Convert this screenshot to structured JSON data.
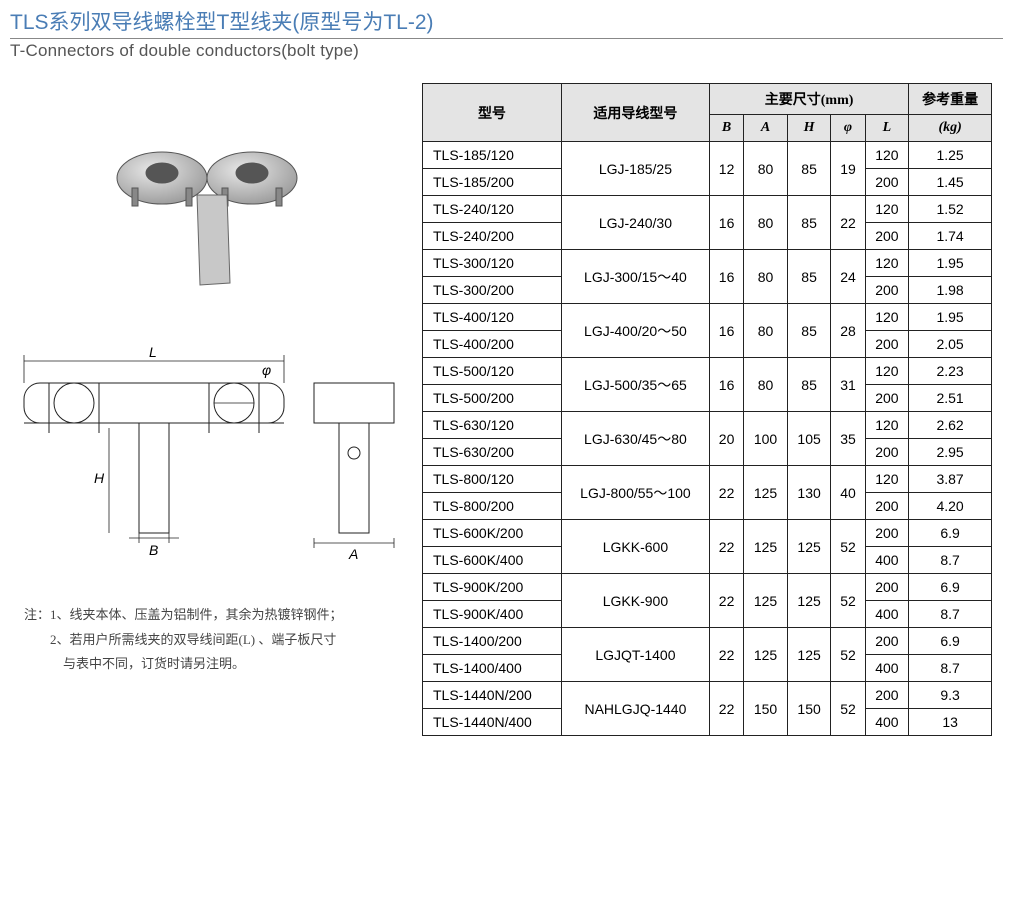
{
  "header": {
    "title_cn": "TLS系列双导线螺栓型T型线夹(原型号为TL-2)",
    "title_en": "T-Connectors of double conductors(bolt type)"
  },
  "notes": {
    "prefix": "注：",
    "line1": "1、线夹本体、压盖为铝制件，其余为热镀锌钢件；",
    "line2": "2、若用户所需线夹的双导线间距(L) 、端子板尺寸",
    "line2b": "与表中不同，订货时请另注明。"
  },
  "table": {
    "headers": {
      "model": "型号",
      "conductor": "适用导线型号",
      "dims": "主要尺寸(mm)",
      "weight": "参考重量",
      "B": "B",
      "A": "A",
      "H": "H",
      "phi": "φ",
      "L": "L",
      "kg": "(kg)"
    },
    "groups": [
      {
        "conductor": "LGJ-185/25",
        "B": "12",
        "A": "80",
        "H": "85",
        "phi": "19",
        "rows": [
          {
            "model": "TLS-185/120",
            "L": "120",
            "kg": "1.25"
          },
          {
            "model": "TLS-185/200",
            "L": "200",
            "kg": "1.45"
          }
        ]
      },
      {
        "conductor": "LGJ-240/30",
        "B": "16",
        "A": "80",
        "H": "85",
        "phi": "22",
        "rows": [
          {
            "model": "TLS-240/120",
            "L": "120",
            "kg": "1.52"
          },
          {
            "model": "TLS-240/200",
            "L": "200",
            "kg": "1.74"
          }
        ]
      },
      {
        "conductor": "LGJ-300/15～40",
        "B": "16",
        "A": "80",
        "H": "85",
        "phi": "24",
        "rows": [
          {
            "model": "TLS-300/120",
            "L": "120",
            "kg": "1.95"
          },
          {
            "model": "TLS-300/200",
            "L": "200",
            "kg": "1.98"
          }
        ]
      },
      {
        "conductor": "LGJ-400/20～50",
        "B": "16",
        "A": "80",
        "H": "85",
        "phi": "28",
        "rows": [
          {
            "model": "TLS-400/120",
            "L": "120",
            "kg": "1.95"
          },
          {
            "model": "TLS-400/200",
            "L": "200",
            "kg": "2.05"
          }
        ]
      },
      {
        "conductor": "LGJ-500/35～65",
        "B": "16",
        "A": "80",
        "H": "85",
        "phi": "31",
        "rows": [
          {
            "model": "TLS-500/120",
            "L": "120",
            "kg": "2.23"
          },
          {
            "model": "TLS-500/200",
            "L": "200",
            "kg": "2.51"
          }
        ]
      },
      {
        "conductor": "LGJ-630/45～80",
        "B": "20",
        "A": "100",
        "H": "105",
        "phi": "35",
        "rows": [
          {
            "model": "TLS-630/120",
            "L": "120",
            "kg": "2.62"
          },
          {
            "model": "TLS-630/200",
            "L": "200",
            "kg": "2.95"
          }
        ]
      },
      {
        "conductor": "LGJ-800/55～100",
        "B": "22",
        "A": "125",
        "H": "130",
        "phi": "40",
        "rows": [
          {
            "model": "TLS-800/120",
            "L": "120",
            "kg": "3.87"
          },
          {
            "model": "TLS-800/200",
            "L": "200",
            "kg": "4.20"
          }
        ]
      },
      {
        "conductor": "LGKK-600",
        "B": "22",
        "A": "125",
        "H": "125",
        "phi": "52",
        "rows": [
          {
            "model": "TLS-600K/200",
            "L": "200",
            "kg": "6.9"
          },
          {
            "model": "TLS-600K/400",
            "L": "400",
            "kg": "8.7"
          }
        ]
      },
      {
        "conductor": "LGKK-900",
        "B": "22",
        "A": "125",
        "H": "125",
        "phi": "52",
        "rows": [
          {
            "model": "TLS-900K/200",
            "L": "200",
            "kg": "6.9"
          },
          {
            "model": "TLS-900K/400",
            "L": "400",
            "kg": "8.7"
          }
        ]
      },
      {
        "conductor": "LGJQT-1400",
        "B": "22",
        "A": "125",
        "H": "125",
        "phi": "52",
        "rows": [
          {
            "model": "TLS-1400/200",
            "L": "200",
            "kg": "6.9"
          },
          {
            "model": "TLS-1400/400",
            "L": "400",
            "kg": "8.7"
          }
        ]
      },
      {
        "conductor": "NAHLGJQ-1440",
        "B": "22",
        "A": "150",
        "H": "150",
        "phi": "52",
        "rows": [
          {
            "model": "TLS-1440N/200",
            "L": "200",
            "kg": "9.3"
          },
          {
            "model": "TLS-1440N/400",
            "L": "400",
            "kg": "13"
          }
        ]
      }
    ]
  },
  "drawing_labels": {
    "L": "L",
    "phi": "φ",
    "H": "H",
    "B": "B",
    "A": "A"
  }
}
